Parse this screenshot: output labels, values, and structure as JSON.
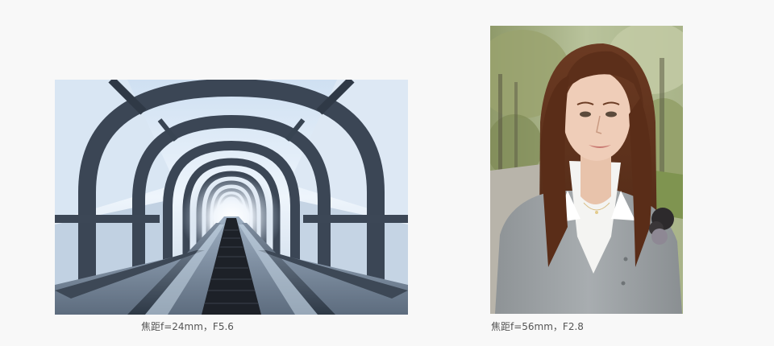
{
  "photos": [
    {
      "subject": "escalator-tunnel",
      "caption": "焦距f=24mm，F5.6"
    },
    {
      "subject": "woman-portrait",
      "caption": "焦距f=56mm，F2.8"
    }
  ],
  "colors": {
    "background": "#f8f8f8",
    "caption_text": "#555555"
  }
}
